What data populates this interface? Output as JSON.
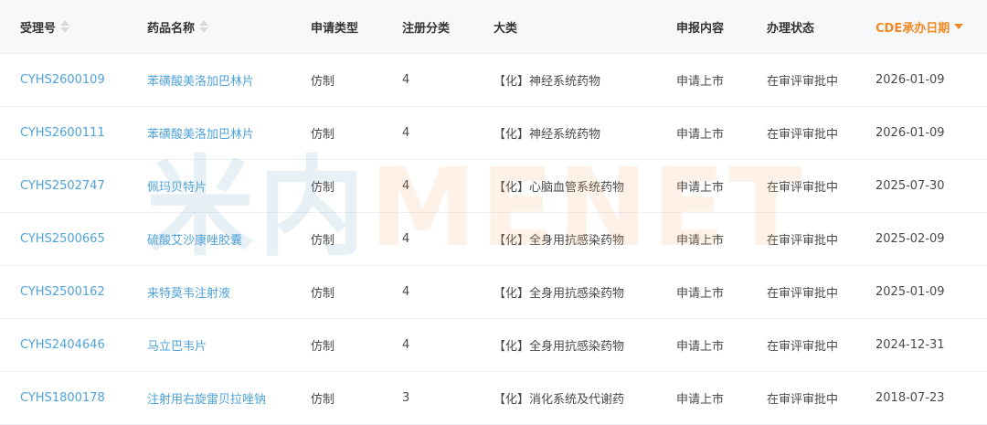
{
  "headers": [
    {
      "label": "受理号",
      "sortable": true
    },
    {
      "label": "药品名称",
      "sortable": true
    },
    {
      "label": "申请类型"
    },
    {
      "label": "注册分类"
    },
    {
      "label": "大类"
    },
    {
      "label": "申报内容"
    },
    {
      "label": "办理状态"
    },
    {
      "label": "CDE承办日期",
      "sortable": true,
      "active": true
    }
  ],
  "rows": [
    {
      "id": "CYHS2600109",
      "name": "苯磺酸美洛加巴林片",
      "type": "仿制",
      "class": "4",
      "category": "【化】神经系统药物",
      "content": "申请上市",
      "status": "在审评审批中",
      "date": "2026-01-09"
    },
    {
      "id": "CYHS2600111",
      "name": "苯磺酸美洛加巴林片",
      "type": "仿制",
      "class": "4",
      "category": "【化】神经系统药物",
      "content": "申请上市",
      "status": "在审评审批中",
      "date": "2026-01-09"
    },
    {
      "id": "CYHS2502747",
      "name": "佩玛贝特片",
      "type": "仿制",
      "class": "4",
      "category": "【化】心脑血管系统药物",
      "content": "申请上市",
      "status": "在审评审批中",
      "date": "2025-07-30"
    },
    {
      "id": "CYHS2500665",
      "name": "硫酸艾沙康唑胶囊",
      "type": "仿制",
      "class": "4",
      "category": "【化】全身用抗感染药物",
      "content": "申请上市",
      "status": "在审评审批中",
      "date": "2025-02-09"
    },
    {
      "id": "CYHS2500162",
      "name": "来特莫韦注射液",
      "type": "仿制",
      "class": "4",
      "category": "【化】全身用抗感染药物",
      "content": "申请上市",
      "status": "在审评审批中",
      "date": "2025-01-09"
    },
    {
      "id": "CYHS2404646",
      "name": "马立巴韦片",
      "type": "仿制",
      "class": "4",
      "category": "【化】全身用抗感染药物",
      "content": "申请上市",
      "status": "在审评审批中",
      "date": "2024-12-31"
    },
    {
      "id": "CYHS1800178",
      "name": "注射用右旋雷贝拉唑钠",
      "type": "仿制",
      "class": "3",
      "category": "【化】消化系统及代谢药",
      "content": "申请上市",
      "status": "在审评审批中",
      "date": "2018-07-23"
    }
  ],
  "watermark": {
    "part1": "米内",
    "part2": "MENET"
  },
  "colors": {
    "link": "#4fa3d9",
    "accent": "#f08a24",
    "header_bg": "#f6f8fa"
  }
}
